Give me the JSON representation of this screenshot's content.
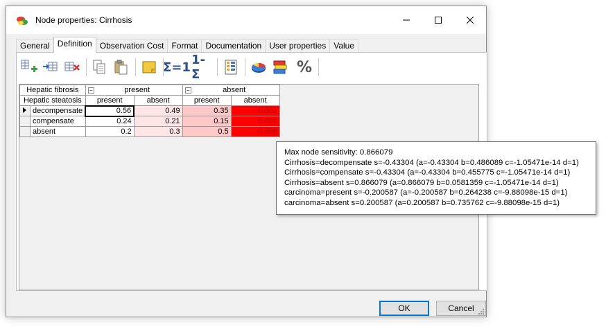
{
  "window": {
    "title": "Node properties: Cirrhosis"
  },
  "tabs": [
    "General",
    "Definition",
    "Observation Cost",
    "Format",
    "Documentation",
    "User properties",
    "Value"
  ],
  "active_tab": "Definition",
  "toolbar": {
    "sum1_label": "Σ=1",
    "complement_label": "1-Σ",
    "percent_label": "%"
  },
  "table": {
    "parent1": {
      "name": "Hepatic fibrosis",
      "states": [
        "present",
        "absent"
      ]
    },
    "parent2": {
      "name": "Hepatic steatosis",
      "states": [
        "present",
        "absent",
        "present",
        "absent"
      ]
    },
    "rows": [
      {
        "label": "decompensate",
        "values": [
          "0.56",
          "0.49",
          "0.35",
          "0.001"
        ]
      },
      {
        "label": "compensate",
        "values": [
          "0.24",
          "0.21",
          "0.15",
          "0.001"
        ]
      },
      {
        "label": "absent",
        "values": [
          "0.2",
          "0.3",
          "0.5",
          "0.998"
        ]
      }
    ],
    "expander_glyph": "−"
  },
  "tooltip": {
    "lines": [
      "Max node sensitivity: 0.866079",
      "Cirrhosis=decompensate  s=-0.43304  (a=-0.43304 b=0.486089 c=-1.05471e-14 d=1)",
      "Cirrhosis=compensate  s=-0.43304  (a=-0.43304 b=0.455775 c=-1.05471e-14 d=1)",
      "Cirrhosis=absent  s=0.866079  (a=0.866079 b=0.0581359 c=-1.05471e-14 d=1)",
      "carcinoma=present  s=-0.200587  (a=-0.200587 b=0.264238 c=-9.88098e-15 d=1)",
      "carcinoma=absent  s=0.200587  (a=0.200587 b=0.735762 c=-9.88098e-15 d=1)"
    ]
  },
  "buttons": {
    "ok": "OK",
    "cancel": "Cancel"
  },
  "colors": {
    "heat_low": "#ffe6e6",
    "heat_mid": "#ffc8c8",
    "heat_high": "#ff0000",
    "accent": "#0078d7"
  },
  "icons": [
    "app-node-icon",
    "add-state-icon",
    "insert-state-icon",
    "delete-state-icon",
    "copy-icon",
    "paste-icon",
    "note-icon",
    "normalize-icon",
    "complement-icon",
    "table-icon",
    "pie-chart-icon",
    "bar-chart-icon",
    "percent-icon",
    "minimize-icon",
    "maximize-icon",
    "close-icon"
  ]
}
